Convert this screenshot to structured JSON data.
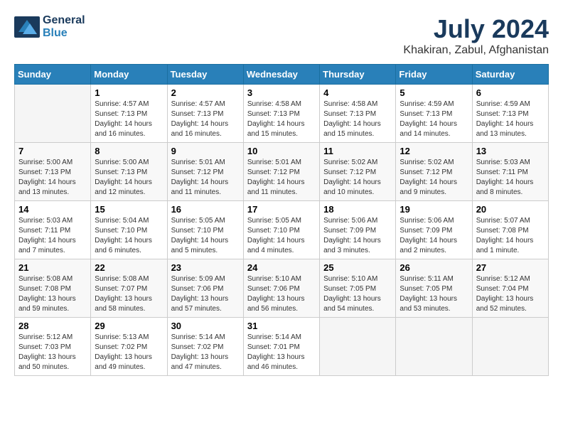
{
  "header": {
    "logo_line1": "General",
    "logo_line2": "Blue",
    "month": "July 2024",
    "location": "Khakiran, Zabul, Afghanistan"
  },
  "calendar": {
    "days_of_week": [
      "Sunday",
      "Monday",
      "Tuesday",
      "Wednesday",
      "Thursday",
      "Friday",
      "Saturday"
    ],
    "weeks": [
      [
        {
          "day": "",
          "sunrise": "",
          "sunset": "",
          "daylight": ""
        },
        {
          "day": "1",
          "sunrise": "Sunrise: 4:57 AM",
          "sunset": "Sunset: 7:13 PM",
          "daylight": "Daylight: 14 hours and 16 minutes."
        },
        {
          "day": "2",
          "sunrise": "Sunrise: 4:57 AM",
          "sunset": "Sunset: 7:13 PM",
          "daylight": "Daylight: 14 hours and 16 minutes."
        },
        {
          "day": "3",
          "sunrise": "Sunrise: 4:58 AM",
          "sunset": "Sunset: 7:13 PM",
          "daylight": "Daylight: 14 hours and 15 minutes."
        },
        {
          "day": "4",
          "sunrise": "Sunrise: 4:58 AM",
          "sunset": "Sunset: 7:13 PM",
          "daylight": "Daylight: 14 hours and 15 minutes."
        },
        {
          "day": "5",
          "sunrise": "Sunrise: 4:59 AM",
          "sunset": "Sunset: 7:13 PM",
          "daylight": "Daylight: 14 hours and 14 minutes."
        },
        {
          "day": "6",
          "sunrise": "Sunrise: 4:59 AM",
          "sunset": "Sunset: 7:13 PM",
          "daylight": "Daylight: 14 hours and 13 minutes."
        }
      ],
      [
        {
          "day": "7",
          "sunrise": "Sunrise: 5:00 AM",
          "sunset": "Sunset: 7:13 PM",
          "daylight": "Daylight: 14 hours and 13 minutes."
        },
        {
          "day": "8",
          "sunrise": "Sunrise: 5:00 AM",
          "sunset": "Sunset: 7:13 PM",
          "daylight": "Daylight: 14 hours and 12 minutes."
        },
        {
          "day": "9",
          "sunrise": "Sunrise: 5:01 AM",
          "sunset": "Sunset: 7:12 PM",
          "daylight": "Daylight: 14 hours and 11 minutes."
        },
        {
          "day": "10",
          "sunrise": "Sunrise: 5:01 AM",
          "sunset": "Sunset: 7:12 PM",
          "daylight": "Daylight: 14 hours and 11 minutes."
        },
        {
          "day": "11",
          "sunrise": "Sunrise: 5:02 AM",
          "sunset": "Sunset: 7:12 PM",
          "daylight": "Daylight: 14 hours and 10 minutes."
        },
        {
          "day": "12",
          "sunrise": "Sunrise: 5:02 AM",
          "sunset": "Sunset: 7:12 PM",
          "daylight": "Daylight: 14 hours and 9 minutes."
        },
        {
          "day": "13",
          "sunrise": "Sunrise: 5:03 AM",
          "sunset": "Sunset: 7:11 PM",
          "daylight": "Daylight: 14 hours and 8 minutes."
        }
      ],
      [
        {
          "day": "14",
          "sunrise": "Sunrise: 5:03 AM",
          "sunset": "Sunset: 7:11 PM",
          "daylight": "Daylight: 14 hours and 7 minutes."
        },
        {
          "day": "15",
          "sunrise": "Sunrise: 5:04 AM",
          "sunset": "Sunset: 7:10 PM",
          "daylight": "Daylight: 14 hours and 6 minutes."
        },
        {
          "day": "16",
          "sunrise": "Sunrise: 5:05 AM",
          "sunset": "Sunset: 7:10 PM",
          "daylight": "Daylight: 14 hours and 5 minutes."
        },
        {
          "day": "17",
          "sunrise": "Sunrise: 5:05 AM",
          "sunset": "Sunset: 7:10 PM",
          "daylight": "Daylight: 14 hours and 4 minutes."
        },
        {
          "day": "18",
          "sunrise": "Sunrise: 5:06 AM",
          "sunset": "Sunset: 7:09 PM",
          "daylight": "Daylight: 14 hours and 3 minutes."
        },
        {
          "day": "19",
          "sunrise": "Sunrise: 5:06 AM",
          "sunset": "Sunset: 7:09 PM",
          "daylight": "Daylight: 14 hours and 2 minutes."
        },
        {
          "day": "20",
          "sunrise": "Sunrise: 5:07 AM",
          "sunset": "Sunset: 7:08 PM",
          "daylight": "Daylight: 14 hours and 1 minute."
        }
      ],
      [
        {
          "day": "21",
          "sunrise": "Sunrise: 5:08 AM",
          "sunset": "Sunset: 7:08 PM",
          "daylight": "Daylight: 13 hours and 59 minutes."
        },
        {
          "day": "22",
          "sunrise": "Sunrise: 5:08 AM",
          "sunset": "Sunset: 7:07 PM",
          "daylight": "Daylight: 13 hours and 58 minutes."
        },
        {
          "day": "23",
          "sunrise": "Sunrise: 5:09 AM",
          "sunset": "Sunset: 7:06 PM",
          "daylight": "Daylight: 13 hours and 57 minutes."
        },
        {
          "day": "24",
          "sunrise": "Sunrise: 5:10 AM",
          "sunset": "Sunset: 7:06 PM",
          "daylight": "Daylight: 13 hours and 56 minutes."
        },
        {
          "day": "25",
          "sunrise": "Sunrise: 5:10 AM",
          "sunset": "Sunset: 7:05 PM",
          "daylight": "Daylight: 13 hours and 54 minutes."
        },
        {
          "day": "26",
          "sunrise": "Sunrise: 5:11 AM",
          "sunset": "Sunset: 7:05 PM",
          "daylight": "Daylight: 13 hours and 53 minutes."
        },
        {
          "day": "27",
          "sunrise": "Sunrise: 5:12 AM",
          "sunset": "Sunset: 7:04 PM",
          "daylight": "Daylight: 13 hours and 52 minutes."
        }
      ],
      [
        {
          "day": "28",
          "sunrise": "Sunrise: 5:12 AM",
          "sunset": "Sunset: 7:03 PM",
          "daylight": "Daylight: 13 hours and 50 minutes."
        },
        {
          "day": "29",
          "sunrise": "Sunrise: 5:13 AM",
          "sunset": "Sunset: 7:02 PM",
          "daylight": "Daylight: 13 hours and 49 minutes."
        },
        {
          "day": "30",
          "sunrise": "Sunrise: 5:14 AM",
          "sunset": "Sunset: 7:02 PM",
          "daylight": "Daylight: 13 hours and 47 minutes."
        },
        {
          "day": "31",
          "sunrise": "Sunrise: 5:14 AM",
          "sunset": "Sunset: 7:01 PM",
          "daylight": "Daylight: 13 hours and 46 minutes."
        },
        {
          "day": "",
          "sunrise": "",
          "sunset": "",
          "daylight": ""
        },
        {
          "day": "",
          "sunrise": "",
          "sunset": "",
          "daylight": ""
        },
        {
          "day": "",
          "sunrise": "",
          "sunset": "",
          "daylight": ""
        }
      ]
    ]
  }
}
